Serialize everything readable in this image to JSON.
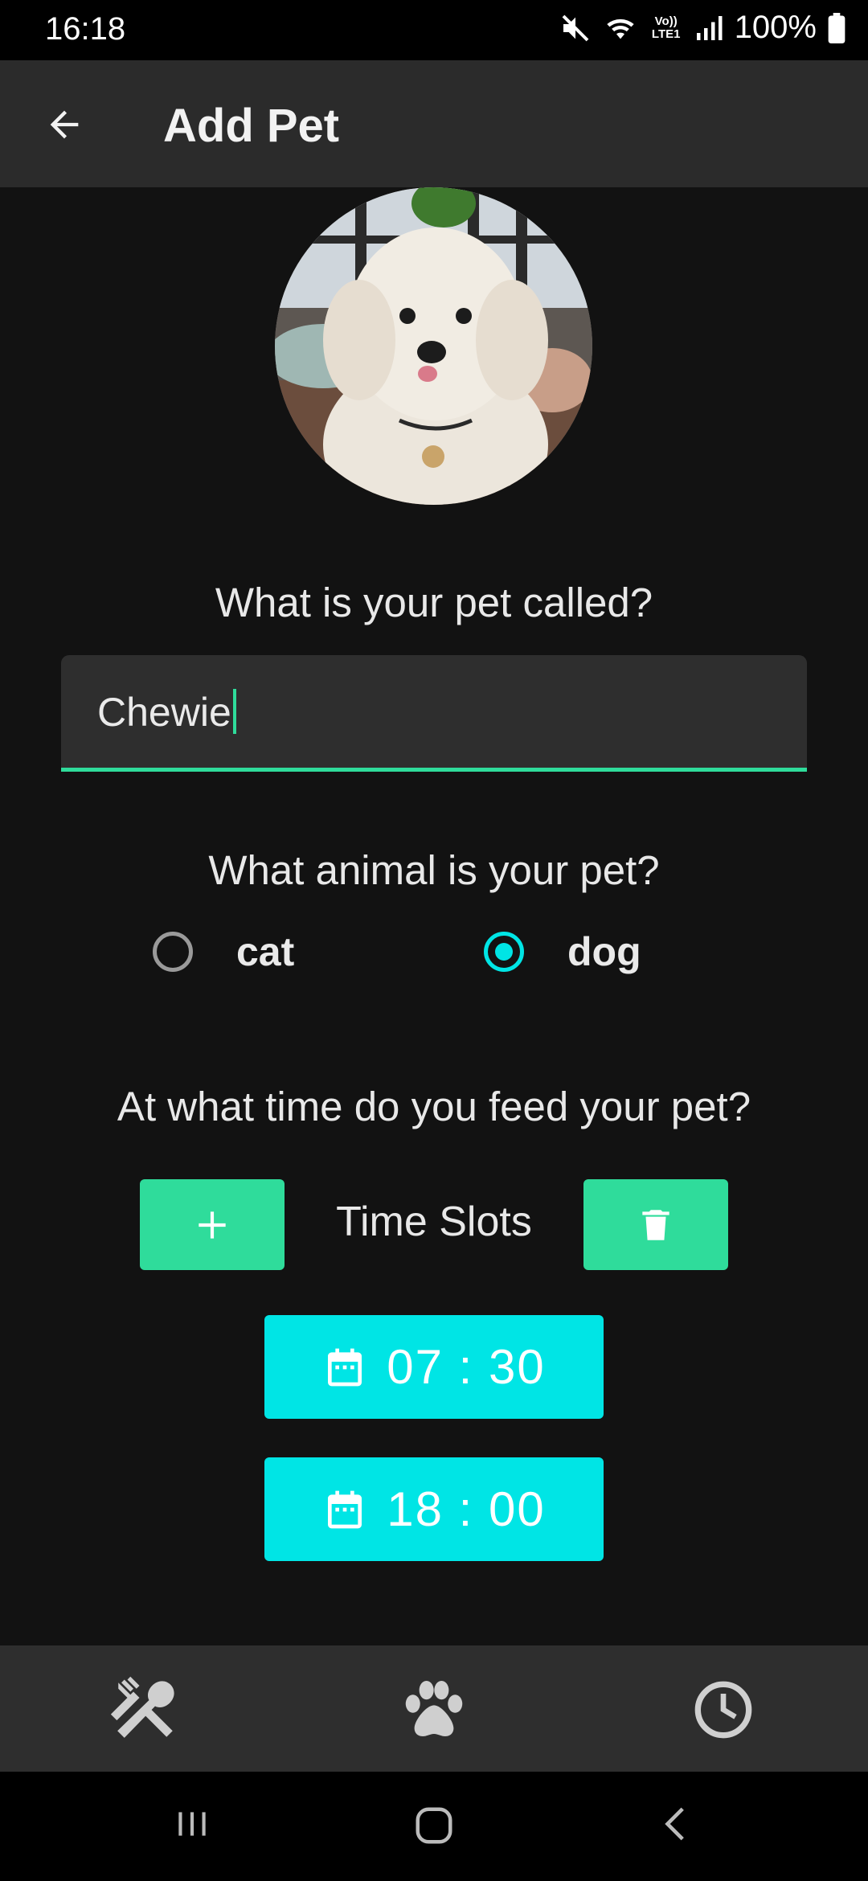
{
  "status_bar": {
    "time": "16:18",
    "battery": "100%",
    "network_label": "Vo)) LTE1"
  },
  "app_bar": {
    "title": "Add Pet"
  },
  "questions": {
    "name": "What is your pet called?",
    "animal": "What animal is your pet?",
    "feed_time": "At what time do you feed your pet?"
  },
  "name_input": {
    "value": "Chewie"
  },
  "animal_options": [
    {
      "label": "cat",
      "selected": false
    },
    {
      "label": "dog",
      "selected": true
    }
  ],
  "time_slots": {
    "label": "Time Slots",
    "slots": [
      "07 : 30",
      "18 : 00"
    ]
  },
  "icons": {
    "back": "arrow-left-icon",
    "add": "plus-icon",
    "delete": "trash-icon",
    "slot": "calendar-icon",
    "nav": [
      "fork-spoon-icon",
      "paw-icon",
      "clock-icon"
    ],
    "system": [
      "recent-apps-icon",
      "home-icon",
      "back-icon"
    ]
  },
  "colors": {
    "accent_green": "#2fdc9b",
    "accent_cyan": "#00e5e5",
    "background": "#121212",
    "appbar": "#2b2b2b"
  }
}
